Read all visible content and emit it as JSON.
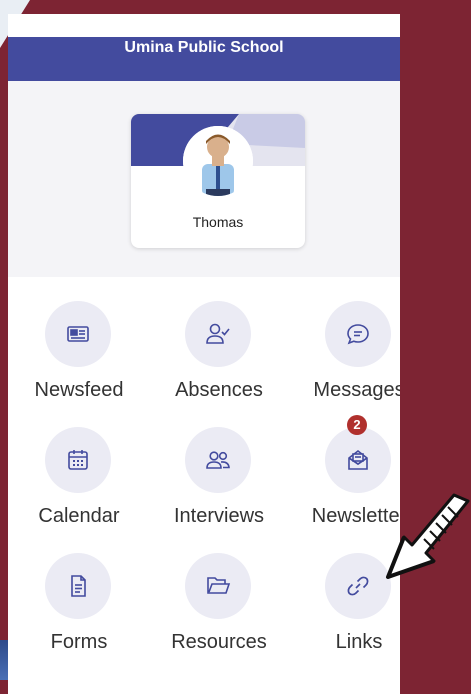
{
  "app": {
    "title": "Umina Public School"
  },
  "student": {
    "name": "Thomas"
  },
  "tiles": [
    {
      "label": "Newsfeed",
      "icon": "newspaper-icon"
    },
    {
      "label": "Absences",
      "icon": "person-check-icon"
    },
    {
      "label": "Messages",
      "icon": "chat-bubble-icon"
    },
    {
      "label": "Calendar",
      "icon": "calendar-icon"
    },
    {
      "label": "Interviews",
      "icon": "people-icon"
    },
    {
      "label": "Newsletter",
      "icon": "envelope-open-icon",
      "badge": "2"
    },
    {
      "label": "Forms",
      "icon": "document-icon"
    },
    {
      "label": "Resources",
      "icon": "folder-icon"
    },
    {
      "label": "Links",
      "icon": "link-icon"
    }
  ],
  "colors": {
    "header": "#434b9e",
    "background": "#7d2433",
    "tile_circle": "#ebebf4",
    "icon_stroke": "#434b9e",
    "badge": "#b0302d"
  }
}
